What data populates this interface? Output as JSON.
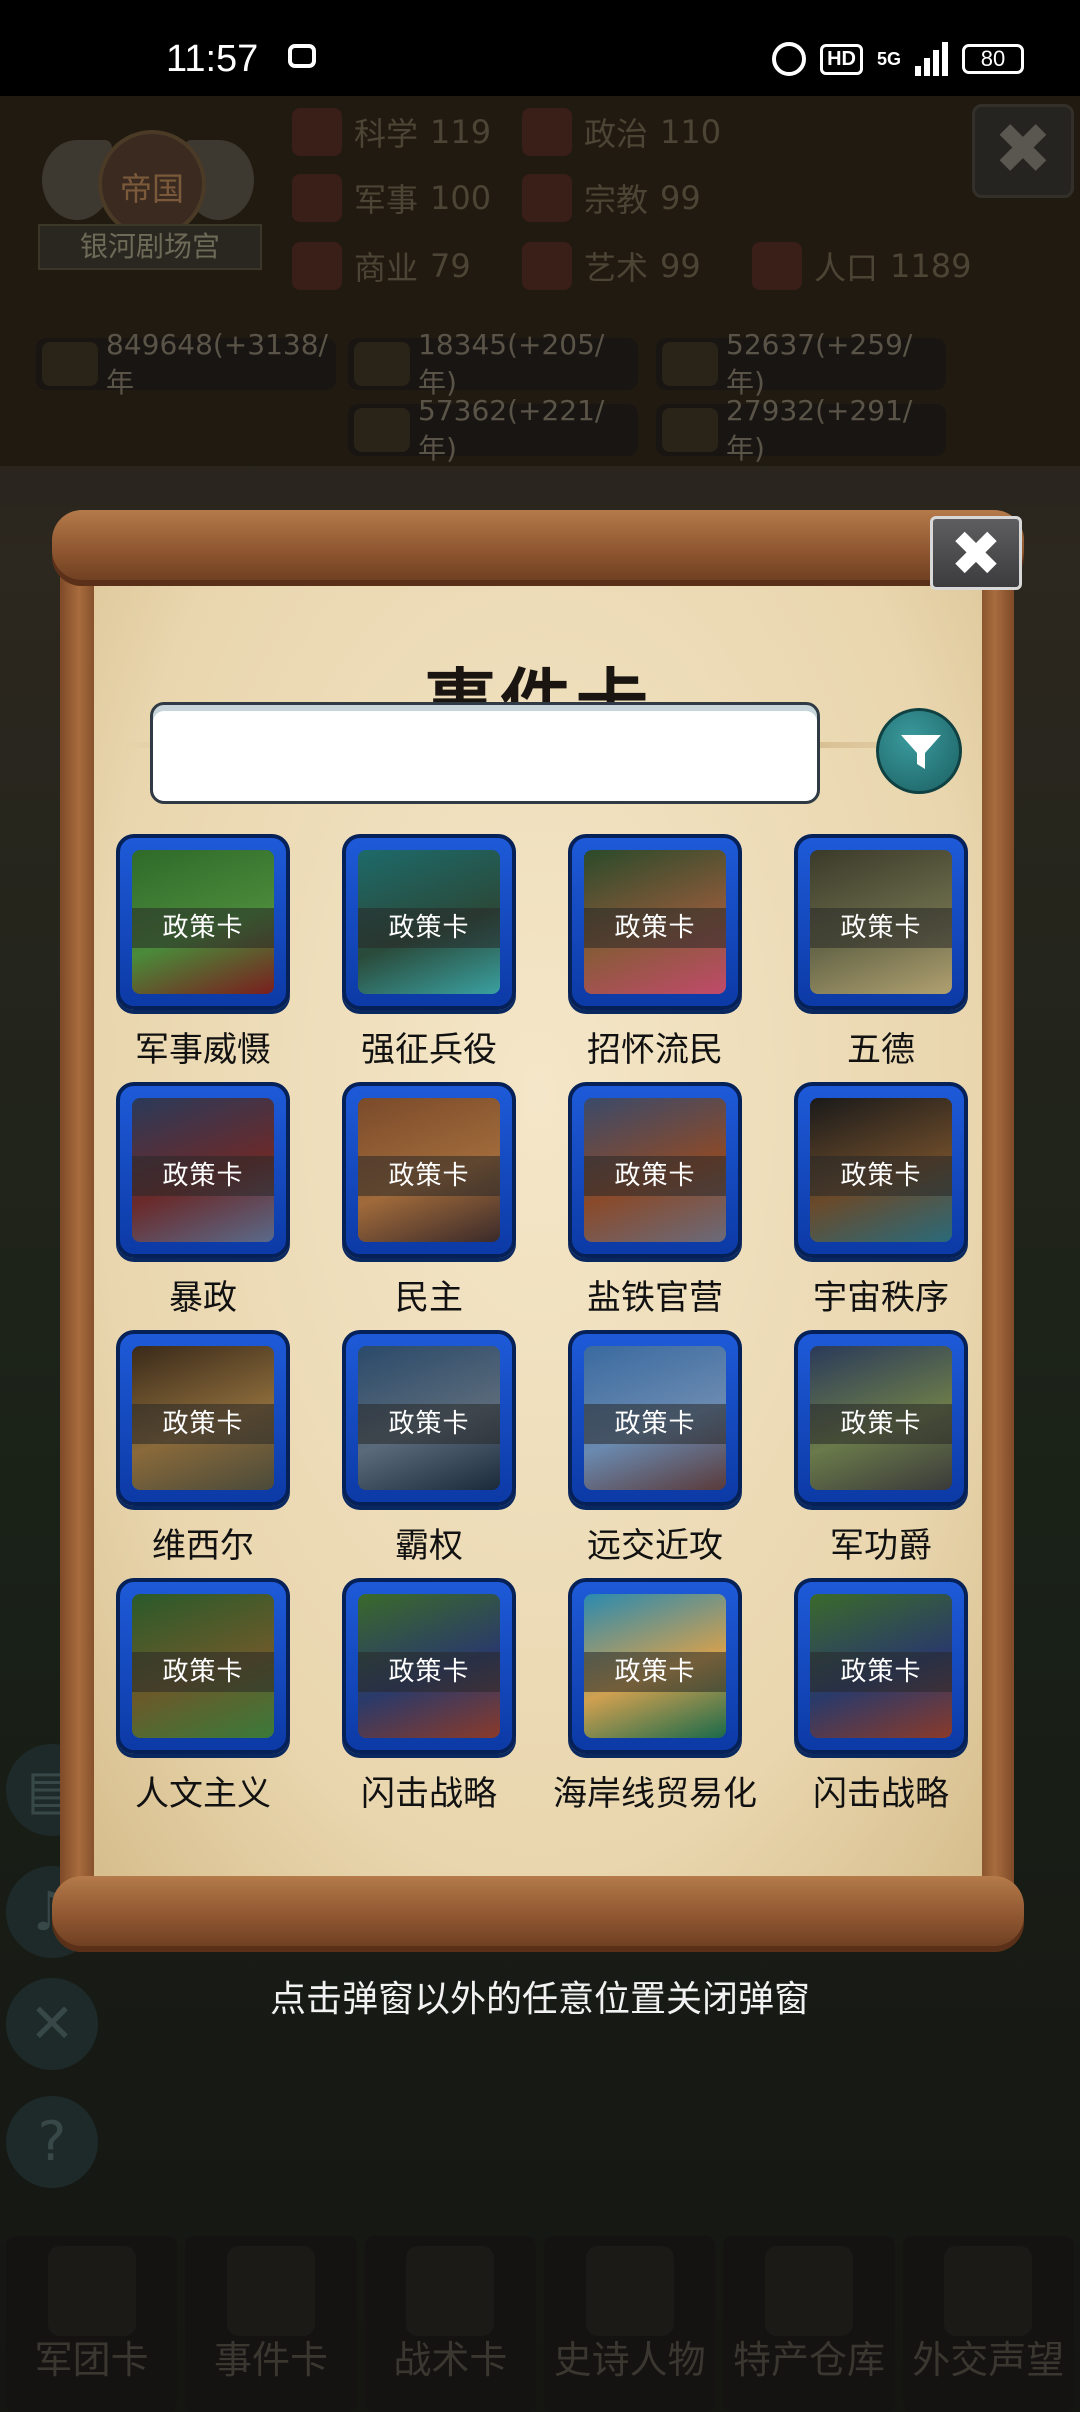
{
  "status_bar": {
    "time": "11:57",
    "hd": "HD",
    "net": "5G",
    "battery": "80"
  },
  "empire": {
    "crest_text": "帝国",
    "name": "银河剧场宫"
  },
  "stats": [
    {
      "name": "科学",
      "value": "119"
    },
    {
      "name": "政治",
      "value": "110"
    },
    {
      "name": "军事",
      "value": "100"
    },
    {
      "name": "宗教",
      "value": "99"
    },
    {
      "name": "商业",
      "value": "79"
    },
    {
      "name": "艺术",
      "value": "99"
    },
    {
      "name": "人口",
      "value": "1189"
    }
  ],
  "resources": [
    "849648(+3138/年",
    "18345(+205/年)",
    "52637(+259/年)",
    "57362(+221/年)",
    "27932(+291/年)"
  ],
  "modal": {
    "title": "事件卡",
    "search_value": "",
    "hint": "点击弹窗以外的任意位置关闭弹窗",
    "card_tag": "政策卡",
    "cards": [
      {
        "label": "军事威慑",
        "colors": [
          "#2f6a2a",
          "#4a8a3a",
          "#7a1e1e"
        ]
      },
      {
        "label": "强征兵役",
        "colors": [
          "#1d6a6a",
          "#2a4a3a",
          "#3aa0a0"
        ]
      },
      {
        "label": "招怀流民",
        "colors": [
          "#2a4a2a",
          "#8a5a3a",
          "#c04a6a"
        ]
      },
      {
        "label": "五德",
        "colors": [
          "#3a3a2a",
          "#6a6a4a",
          "#b0a070"
        ]
      },
      {
        "label": "暴政",
        "colors": [
          "#2a3a5a",
          "#6a2a2a",
          "#5a6a8a"
        ]
      },
      {
        "label": "民主",
        "colors": [
          "#7a4a2a",
          "#a06a3a",
          "#3a2a2a"
        ]
      },
      {
        "label": "盐铁官营",
        "colors": [
          "#3a4a6a",
          "#8a4a2a",
          "#6a6a7a"
        ]
      },
      {
        "label": "宇宙秩序",
        "colors": [
          "#1a1a1a",
          "#6a4a2a",
          "#2a6a7a"
        ]
      },
      {
        "label": "维西尔",
        "colors": [
          "#3a2a1a",
          "#8a6a3a",
          "#4a4a3a"
        ]
      },
      {
        "label": "霸权",
        "colors": [
          "#2a4a6a",
          "#5a6a7a",
          "#1a2a3a"
        ]
      },
      {
        "label": "远交近攻",
        "colors": [
          "#3a6aa0",
          "#6a8ab0",
          "#5a3a3a"
        ]
      },
      {
        "label": "军功爵",
        "colors": [
          "#2a3a5a",
          "#6a7a4a",
          "#3a3a3a"
        ]
      },
      {
        "label": "人文主义",
        "colors": [
          "#2a5a2a",
          "#6a5a2a",
          "#3a7a3a"
        ]
      },
      {
        "label": "闪击战略",
        "colors": [
          "#3a6a2a",
          "#2a3a6a",
          "#8a3a2a"
        ]
      },
      {
        "label": "海岸线贸易化",
        "colors": [
          "#2a8ab0",
          "#d0a050",
          "#1a6a4a"
        ]
      },
      {
        "label": "闪击战略",
        "colors": [
          "#3a6a2a",
          "#2a3a6a",
          "#8a3a2a"
        ]
      }
    ]
  },
  "bottom_nav": [
    "军团卡",
    "事件卡",
    "战术卡",
    "史诗人物",
    "特产仓库",
    "外交声望"
  ]
}
